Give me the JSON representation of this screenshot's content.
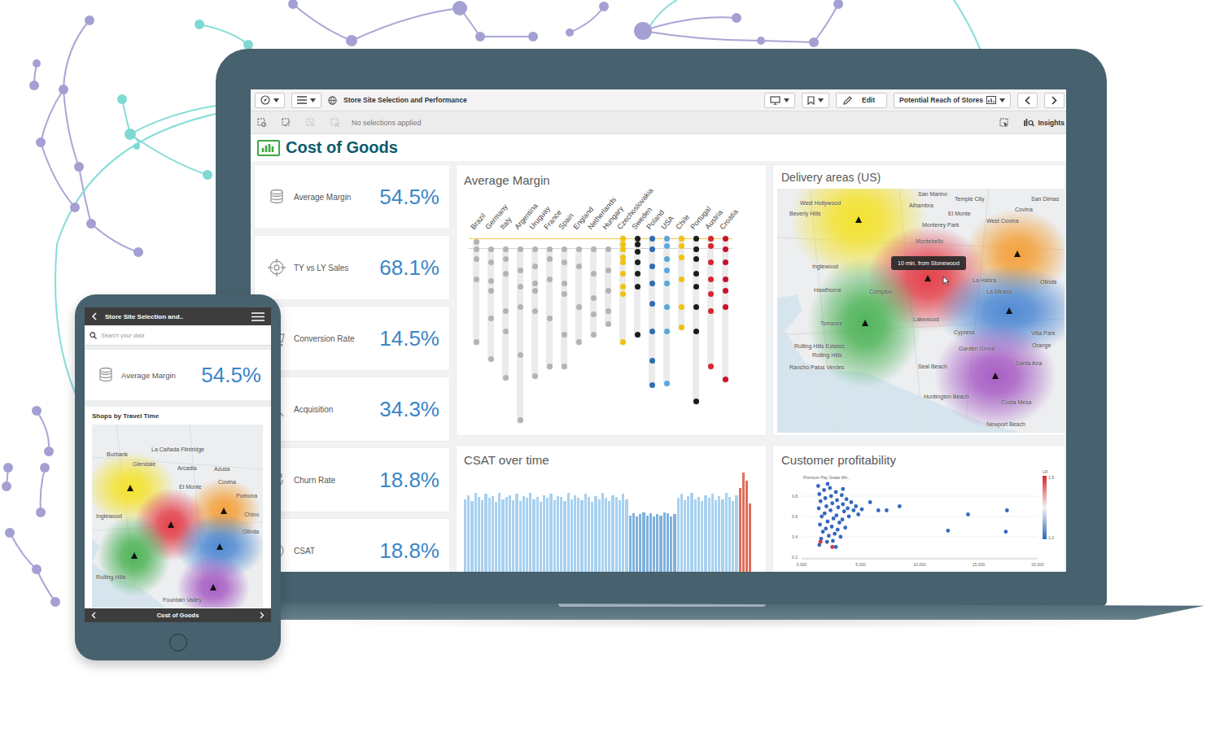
{
  "laptop": {
    "toolbar": {
      "app_title": "Store Site Selection and Performance",
      "edit_label": "Edit",
      "sheet_name": "Potential Reach of Stores"
    },
    "selection_bar": {
      "text": "No selections applied",
      "insights_label": "Insights"
    },
    "sheet_title": "Cost of Goods",
    "kpis": [
      {
        "label": "Average Margin",
        "value": "54.5%"
      },
      {
        "label": "TY vs LY Sales",
        "value": "68.1%"
      },
      {
        "label": "Conversion Rate",
        "value": "14.5%"
      },
      {
        "label": "Acquisition",
        "value": "34.3%"
      },
      {
        "label": "Churn Rate",
        "value": "18.8%"
      },
      {
        "label": "CSAT",
        "value": "18.8%"
      }
    ],
    "average_margin": {
      "title": "Average Margin",
      "reference_lines": [
        {
          "value": 99,
          "color": "#f2c94c"
        },
        {
          "value": 94,
          "color": "#d2d2d2"
        }
      ],
      "countries": [
        {
          "name": "Brazil",
          "color": "#b3b3b3",
          "values": [
            97,
            93,
            88,
            77,
            43
          ]
        },
        {
          "name": "Germany",
          "color": "#b3b3b3",
          "values": [
            93,
            86,
            76,
            71,
            56,
            34
          ]
        },
        {
          "name": "Italy",
          "color": "#b3b3b3",
          "values": [
            93,
            88,
            80,
            60,
            49,
            24
          ]
        },
        {
          "name": "Argentina",
          "color": "#b3b3b3",
          "values": [
            93,
            82,
            73,
            62,
            36,
            1
          ]
        },
        {
          "name": "Uruguay",
          "color": "#b3b3b3",
          "values": [
            93,
            84,
            75,
            71,
            60,
            25
          ]
        },
        {
          "name": "France",
          "color": "#b3b3b3",
          "values": [
            93,
            88,
            77,
            56,
            30
          ]
        },
        {
          "name": "Spain",
          "color": "#b3b3b3",
          "values": [
            93,
            86,
            75,
            69,
            47,
            30
          ]
        },
        {
          "name": "England",
          "color": "#b3b3b3",
          "values": [
            93,
            84,
            62,
            43
          ]
        },
        {
          "name": "Netherlands",
          "color": "#b3b3b3",
          "values": [
            93,
            80,
            67,
            58,
            47
          ]
        },
        {
          "name": "Hungary",
          "color": "#b3b3b3",
          "values": [
            93,
            82,
            71,
            60,
            53
          ]
        },
        {
          "name": "Czechoslovakia",
          "color": "#f4c20d",
          "values": [
            99,
            96,
            93,
            89,
            86,
            80,
            73,
            69,
            43
          ]
        },
        {
          "name": "Sweden",
          "color": "#1c1c1c",
          "values": [
            99,
            96,
            92,
            86,
            80,
            73,
            47
          ]
        },
        {
          "name": "Poland",
          "color": "#2f6db5",
          "values": [
            99,
            93,
            84,
            75,
            64,
            49,
            33,
            20
          ]
        },
        {
          "name": "USA",
          "color": "#5aa7e0",
          "values": [
            99,
            95,
            88,
            82,
            75,
            62,
            49,
            21
          ]
        },
        {
          "name": "Chile",
          "color": "#f4c20d",
          "values": [
            99,
            95,
            89,
            77,
            62,
            51
          ]
        },
        {
          "name": "Portugal",
          "color": "#1c1c1c",
          "values": [
            99,
            93,
            88,
            80,
            73,
            62,
            49,
            11
          ]
        },
        {
          "name": "Austria",
          "color": "#d7262e",
          "values": [
            99,
            95,
            86,
            77,
            69,
            60,
            30
          ]
        },
        {
          "name": "Croatia",
          "color": "#c8102e",
          "values": [
            99,
            93,
            86,
            77,
            71,
            62,
            23
          ]
        }
      ]
    },
    "delivery_map": {
      "title": "Delivery areas (US)",
      "tooltip": "10 min. from Stonewood",
      "areas": [
        {
          "color": "#f5e11a"
        },
        {
          "color": "#f59a2a"
        },
        {
          "color": "#e32f3a"
        },
        {
          "color": "#3fae49"
        },
        {
          "color": "#3f7fd0"
        },
        {
          "color": "#a04fc0"
        }
      ],
      "places": [
        "West Hollywood",
        "San Marino",
        "Temple City",
        "San Dimas",
        "Alhambra",
        "Covina",
        "Beverly Hills",
        "El Monte",
        "West Covina",
        "Monterey Park",
        "Montebello",
        "Inglewood",
        "La Habra",
        "Olinda",
        "Hawthorne",
        "Compton",
        "La Mirada",
        "Lakewood",
        "Torrance",
        "Cypress",
        "Villa Park",
        "Orange",
        "Rolling Hills Estates",
        "Garden Grove",
        "Rolling Hills",
        "Santa Ana",
        "Seal Beach",
        "Rancho Palos Verdes",
        "Huntington Beach",
        "Costa Mesa",
        "Newport Beach"
      ]
    },
    "csat": {
      "title": "CSAT over time",
      "segments": [
        {
          "color": "#a8d1f0",
          "values": [
            74,
            78,
            72,
            80,
            76,
            73,
            79,
            75,
            77,
            71,
            80,
            74,
            76,
            78,
            73,
            79,
            72,
            77,
            75,
            80,
            74,
            76,
            71,
            78,
            75,
            79,
            73,
            77,
            76,
            72,
            80,
            74,
            78,
            75,
            73,
            79,
            76,
            71,
            77,
            74,
            80,
            75,
            72,
            78,
            76,
            73,
            79,
            74
          ]
        },
        {
          "color": "#7fb1dd",
          "values": [
            58,
            60,
            57,
            59,
            61,
            58,
            60,
            57,
            59,
            58,
            61,
            60,
            57,
            59
          ]
        },
        {
          "color": "#a8d1f0",
          "values": [
            75,
            79,
            73,
            77,
            80,
            74,
            76,
            72,
            78,
            75,
            79,
            73,
            77,
            74,
            80,
            76,
            72,
            78
          ]
        },
        {
          "color": "#e0705a",
          "values": [
            85,
            100,
            92,
            70
          ]
        }
      ]
    },
    "profitability": {
      "title": "Customer profitability",
      "subtitle": "Premium Pay Grade Wit...",
      "y_ticks": [
        "0.8",
        "0.6",
        "0.4",
        "0.2"
      ],
      "x_ticks": [
        "0.000",
        "5,000",
        "10,000",
        "15,000",
        "20,000"
      ],
      "legend": {
        "title": "LR",
        "max": "1.6",
        "min": "1.2"
      },
      "series": [
        {
          "color": "#3568c0",
          "points": [
            [
              1400,
              0.9
            ],
            [
              1500,
              0.82
            ],
            [
              1600,
              0.75
            ],
            [
              1450,
              0.68
            ],
            [
              1700,
              0.6
            ],
            [
              1550,
              0.52
            ],
            [
              1800,
              0.45
            ],
            [
              1650,
              0.38
            ],
            [
              1500,
              0.32
            ],
            [
              1900,
              0.86
            ],
            [
              2000,
              0.78
            ],
            [
              2100,
              0.7
            ],
            [
              1950,
              0.63
            ],
            [
              2200,
              0.55
            ],
            [
              2050,
              0.48
            ],
            [
              2300,
              0.41
            ],
            [
              2150,
              0.35
            ],
            [
              2400,
              0.88
            ],
            [
              2500,
              0.8
            ],
            [
              2600,
              0.73
            ],
            [
              2450,
              0.66
            ],
            [
              2700,
              0.58
            ],
            [
              2550,
              0.5
            ],
            [
              2800,
              0.43
            ],
            [
              2650,
              0.36
            ],
            [
              2900,
              0.84
            ],
            [
              3000,
              0.76
            ],
            [
              3100,
              0.69
            ],
            [
              2950,
              0.61
            ],
            [
              3200,
              0.54
            ],
            [
              3050,
              0.47
            ],
            [
              3300,
              0.4
            ],
            [
              3400,
              0.81
            ],
            [
              3500,
              0.72
            ],
            [
              3600,
              0.65
            ],
            [
              3450,
              0.57
            ],
            [
              3700,
              0.49
            ],
            [
              3800,
              0.77
            ],
            [
              3900,
              0.68
            ],
            [
              4000,
              0.6
            ],
            [
              4200,
              0.74
            ],
            [
              4400,
              0.66
            ],
            [
              4600,
              0.7
            ],
            [
              4800,
              0.62
            ],
            [
              5100,
              0.67
            ],
            [
              3500,
              0.87
            ],
            [
              2200,
              0.92
            ],
            [
              2900,
              0.3
            ],
            [
              5800,
              0.74
            ],
            [
              6500,
              0.66
            ],
            [
              7200,
              0.66
            ],
            [
              8300,
              0.7
            ],
            [
              12400,
              0.46
            ],
            [
              14100,
              0.62
            ],
            [
              17400,
              0.66
            ],
            [
              17300,
              0.45
            ]
          ]
        },
        {
          "color": "#d9363e",
          "points": [
            [
              1600,
              0.35
            ],
            [
              2600,
              0.3
            ]
          ]
        }
      ]
    }
  },
  "phone": {
    "title": "Store Site Selection and..",
    "search": {
      "placeholder": "Search your data"
    },
    "kpi": {
      "label": "Average Margin",
      "value": "54.5%"
    },
    "map": {
      "title": "Shops by Travel Time",
      "areas": [
        {
          "color": "#f5e11a"
        },
        {
          "color": "#f59a2a"
        },
        {
          "color": "#e32f3a"
        },
        {
          "color": "#3fae49"
        },
        {
          "color": "#3f7fd0"
        },
        {
          "color": "#a04fc0"
        }
      ],
      "places": [
        "Burbank",
        "La Cañada Flintridge",
        "Glendale",
        "Arcadia",
        "Azusa",
        "Covina",
        "El Monte",
        "Pomona",
        "Inglewood",
        "Chino",
        "Olinda",
        "Rolling Hills",
        "Fountain Valley"
      ]
    },
    "footer": {
      "title": "Cost of Goods"
    }
  }
}
